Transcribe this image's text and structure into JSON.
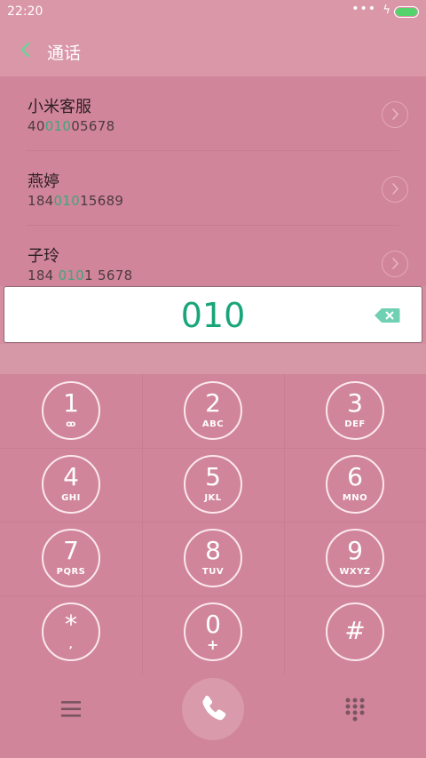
{
  "status_bar": {
    "time": "22:20",
    "more_dots": "•••",
    "charging": "ϟ"
  },
  "header": {
    "title": "通话",
    "back_glyph": "‹"
  },
  "contacts": [
    {
      "name": "小米客服",
      "num_pre": "40",
      "num_match": "010",
      "num_post": "05678"
    },
    {
      "name": "燕婷",
      "num_pre": "184",
      "num_match": "010",
      "num_post": "15689"
    },
    {
      "name": "子玲",
      "num_pre": "184 ",
      "num_match": "010",
      "num_post": "1 5678"
    }
  ],
  "dial_input": {
    "value": "010"
  },
  "keypad": [
    {
      "digit": "1",
      "letters": "ꝏ"
    },
    {
      "digit": "2",
      "letters": "ABC"
    },
    {
      "digit": "3",
      "letters": "DEF"
    },
    {
      "digit": "4",
      "letters": "GHI"
    },
    {
      "digit": "5",
      "letters": "JKL"
    },
    {
      "digit": "6",
      "letters": "MNO"
    },
    {
      "digit": "7",
      "letters": "PQRS"
    },
    {
      "digit": "8",
      "letters": "TUV"
    },
    {
      "digit": "9",
      "letters": "WXYZ"
    },
    {
      "digit": "*",
      "letters": ","
    },
    {
      "digit": "0",
      "letters": "+"
    },
    {
      "digit": "#",
      "letters": ""
    }
  ],
  "colors": {
    "accent": "#19a57a",
    "match": "#3fa67d",
    "background": "#d0859a",
    "battery": "#54d26b"
  },
  "icons": {
    "back": "chevron-left-icon",
    "backspace": "backspace-icon",
    "menu": "menu-icon",
    "call": "phone-icon",
    "dialpad": "dialpad-icon"
  }
}
